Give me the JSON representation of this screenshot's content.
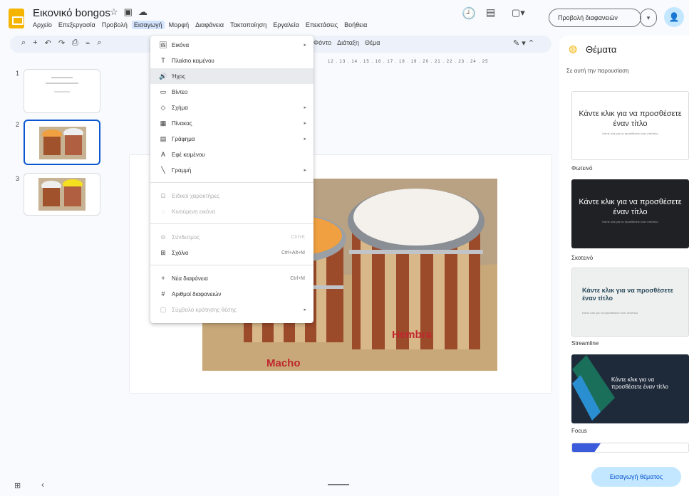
{
  "app": {
    "doc_title": "Εικονικό bongos",
    "menubar": [
      "Αρχείο",
      "Επεξεργασία",
      "Προβολή",
      "Εισαγωγή",
      "Μορφή",
      "Διαφάνεια",
      "Τακτοποίηση",
      "Εργαλεία",
      "Επεκτάσεις",
      "Βοήθεια"
    ],
    "slideshow_label": "Προβολή διαφανειών"
  },
  "toolbar": {
    "right_items": [
      "Φόντο",
      "Διάταξη",
      "Θέμα"
    ]
  },
  "filmstrip": {
    "slide_numbers": [
      "1",
      "2",
      "3"
    ]
  },
  "slide": {
    "label_hembra": "Hembra",
    "label_macho": "Macho",
    "ruler_marks": "12 . 13 . 14 . 15 . 16 . 17 . 18 . 19 . 20 . 21 . 22 . 23 . 24 . 25"
  },
  "insert_menu": {
    "items": [
      {
        "icon": "🖼",
        "label": "Εικόνα",
        "shortcut": "",
        "arrow": "▸",
        "disabled": false
      },
      {
        "icon": "T",
        "label": "Πλαίσιο κειμένου",
        "shortcut": "",
        "arrow": "",
        "disabled": false
      },
      {
        "icon": "🔊",
        "label": "Ήχος",
        "shortcut": "",
        "arrow": "",
        "disabled": false,
        "highlight": true
      },
      {
        "icon": "▭",
        "label": "Βίντεο",
        "shortcut": "",
        "arrow": "",
        "disabled": false
      },
      {
        "icon": "◇",
        "label": "Σχήμα",
        "shortcut": "",
        "arrow": "▸",
        "disabled": false
      },
      {
        "icon": "▦",
        "label": "Πίνακας",
        "shortcut": "",
        "arrow": "▸",
        "disabled": false
      },
      {
        "icon": "▤",
        "label": "Γράφημα",
        "shortcut": "",
        "arrow": "▸",
        "disabled": false
      },
      {
        "icon": "A",
        "label": "Εφέ κειμένου",
        "shortcut": "",
        "arrow": "",
        "disabled": false
      },
      {
        "icon": "╲",
        "label": "Γραμμή",
        "shortcut": "",
        "arrow": "▸",
        "disabled": false
      },
      {
        "icon": "Ω",
        "label": "Ειδικοί χαρακτήρες",
        "shortcut": "",
        "arrow": "",
        "disabled": true
      },
      {
        "icon": "◌",
        "label": "Κινούμενη εικόνα",
        "shortcut": "",
        "arrow": "",
        "disabled": true
      },
      {
        "icon": "⊝",
        "label": "Σύνδεσμος",
        "shortcut": "Ctrl+K",
        "arrow": "",
        "disabled": true
      },
      {
        "icon": "⊞",
        "label": "Σχόλιο",
        "shortcut": "Ctrl+Alt+M",
        "arrow": "",
        "disabled": false
      },
      {
        "icon": "+",
        "label": "Νέα διαφάνεια",
        "shortcut": "Ctrl+M",
        "arrow": "",
        "disabled": false
      },
      {
        "icon": "#",
        "label": "Αριθμοί διαφανειών",
        "shortcut": "",
        "arrow": "",
        "disabled": false
      },
      {
        "icon": "▢",
        "label": "Σύμβολο κράτησης θέσης",
        "shortcut": "",
        "arrow": "▸",
        "disabled": true
      }
    ]
  },
  "themes": {
    "title": "Θέματα",
    "subtitle": "Σε αυτή την παρουσίαση",
    "card_title_2line": "Κάντε κλικ για να προσθέσετε έναν τίτλο",
    "card_sub": "Κάντε κλικ για να προσθέσετε έναν υπότιτλο",
    "names": [
      "Φωτεινό",
      "Σκοτεινό",
      "Streamline",
      "Focus"
    ],
    "import_label": "Εισαγωγή θέματος"
  }
}
